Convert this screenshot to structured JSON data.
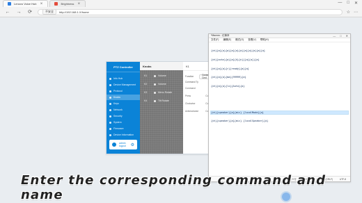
{
  "browser": {
    "tabs": [
      {
        "title": "Lenovo Voice Hub"
      },
      {
        "title": "Brightness"
      }
    ],
    "address": {
      "badge": "不安全",
      "url": "http://192.168.1.X/home"
    },
    "window_controls": [
      "—",
      "□",
      "✕"
    ],
    "nav": {
      "back": "←",
      "forward": "→",
      "reload": "⟳"
    },
    "right_icons": [
      "☆",
      "⋯"
    ]
  },
  "app": {
    "sidebar": {
      "title": "PTZ Controller",
      "items": [
        {
          "label": "Info Hub"
        },
        {
          "label": "Device Management"
        },
        {
          "label": "Protocol"
        },
        {
          "label": "Knobs",
          "active": true
        },
        {
          "label": "Keys"
        },
        {
          "label": "Network"
        },
        {
          "label": "Security"
        },
        {
          "label": "System"
        },
        {
          "label": "Firmware"
        },
        {
          "label": "Device Information"
        }
      ],
      "footer": {
        "line1": "admin",
        "line2": "logout"
      }
    },
    "center": {
      "header": "Knobs",
      "rows": [
        {
          "id": "K1",
          "action": "Volume"
        },
        {
          "id": "K2",
          "action": "Volume"
        },
        {
          "id": "K3",
          "action": "Menu Rotate"
        },
        {
          "id": "K4",
          "action": "Tilt Rotate"
        }
      ]
    },
    "right_panel": {
      "title": "K1",
      "function_label": "Function",
      "function_value": "Custom Cmd",
      "command_label": "Command Ty",
      "stack": [
        {
          "k": "Command",
          "v": "Sens"
        },
        {
          "k": "Press",
          "v": "Command"
        },
        {
          "k": "Clockwise",
          "v": "Command"
        },
        {
          "k": "Anticlockwise",
          "v": "Command"
        }
      ]
    }
  },
  "notepad": {
    "title": "*Macros - 记事本",
    "window_controls": [
      "—",
      "□",
      "✕"
    ],
    "menu": [
      "文件(F)",
      "编辑(E)",
      "格式(O)",
      "查看(V)",
      "帮助(H)"
    ],
    "lines": [
      "{ch}{a}{a}{a}{a}{a}{a}{a}{a}{a}{a}{a}",
      "{ch}{ackn}{a}{a}{k}{n}{{a}{a}}{a}",
      "{ch}{a}{a}{r}{ready}{a}{a}",
      "{ch}{a}{a}{ma}{99999}{a}",
      "{ch}{a}{a}{lx}{Auto}{a}",
      "",
      "",
      "",
      "{ch}{speaker}{a}{mic} {localMode}{a}",
      "{ch}{speaker}{a}{mic} {localSpeaker}{a}"
    ],
    "selected_line_index": 8,
    "status": [
      "第 9 行",
      "100%",
      "Windows (CRLF)",
      "UTF-8"
    ]
  },
  "caption": "Enter the corresponding command and name"
}
